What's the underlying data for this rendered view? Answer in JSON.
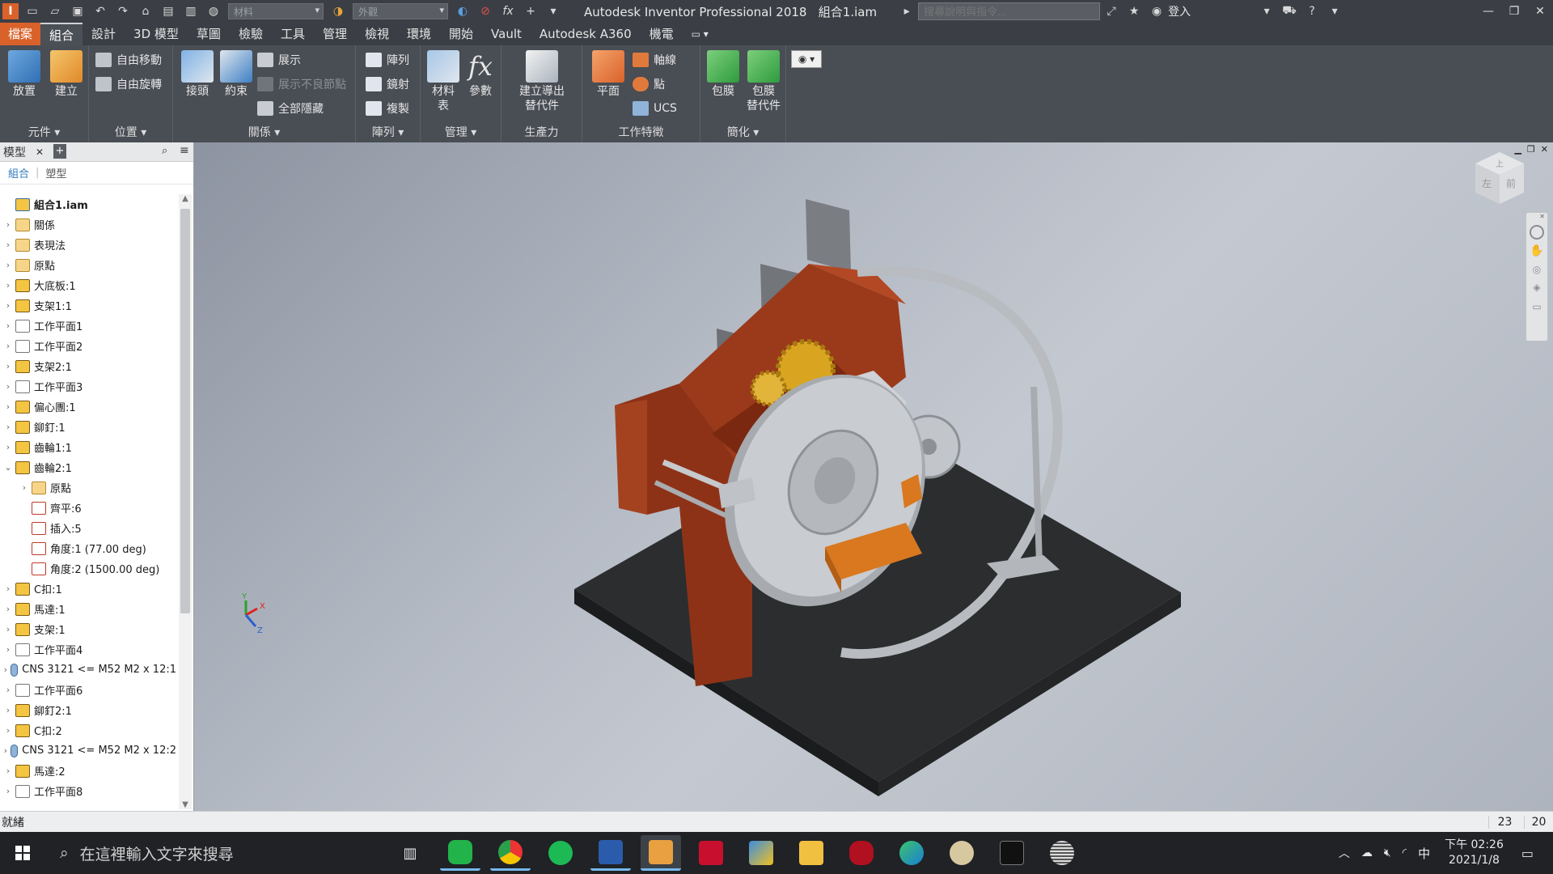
{
  "window": {
    "app_title": "Autodesk Inventor Professional 2018",
    "document": "組合1.iam",
    "search_placeholder": "搜尋說明與指令...",
    "sign_in": "登入",
    "material_placeholder": "材料",
    "appearance_placeholder": "外觀"
  },
  "menu": {
    "tabs": [
      "檔案",
      "組合",
      "設計",
      "3D 模型",
      "草圖",
      "檢驗",
      "工具",
      "管理",
      "檢視",
      "環境",
      "開始",
      "Vault",
      "Autodesk A360",
      "機電"
    ]
  },
  "ribbon": {
    "component": {
      "label": "元件",
      "place": "放置",
      "create": "建立"
    },
    "position": {
      "label": "位置",
      "free_move": "自由移動",
      "free_rotate": "自由旋轉"
    },
    "relationships": {
      "label": "關係",
      "joint": "接頭",
      "constrain": "約束",
      "show": "展示",
      "show_sick": "展示不良節點",
      "hide_all": "全部隱藏"
    },
    "pattern": {
      "label": "陣列",
      "pattern": "陣列",
      "mirror": "鏡射",
      "copy": "複製"
    },
    "manage": {
      "label": "管理",
      "bom_line1": "材料",
      "bom_line2": "表",
      "parameters": "參數"
    },
    "productivity": {
      "label": "生產力",
      "line1": "建立導出",
      "line2": "替代件"
    },
    "work_features": {
      "label": "工作特徵",
      "plane": "平面",
      "axis": "軸線",
      "point": "點",
      "ucs": "UCS"
    },
    "simplification": {
      "label": "簡化",
      "shrinkwrap": "包膜",
      "shrinkwrap_sub_line1": "包膜",
      "shrinkwrap_sub_line2": "替代件"
    }
  },
  "browser": {
    "title": "模型",
    "sub_tabs": [
      "組合",
      "塑型"
    ],
    "items": [
      {
        "label": "組合1.iam",
        "icon": "assembly",
        "indent": 0,
        "expand": "",
        "bold": true
      },
      {
        "label": "關係",
        "icon": "folder",
        "indent": 0,
        "expand": "›"
      },
      {
        "label": "表現法",
        "icon": "folder",
        "indent": 0,
        "expand": "›"
      },
      {
        "label": "原點",
        "icon": "folder",
        "indent": 0,
        "expand": "›"
      },
      {
        "label": "大底板:1",
        "icon": "part",
        "indent": 0,
        "expand": "›"
      },
      {
        "label": "支架1:1",
        "icon": "part",
        "indent": 0,
        "expand": "›"
      },
      {
        "label": "工作平面1",
        "icon": "plane",
        "indent": 0,
        "expand": "›"
      },
      {
        "label": "工作平面2",
        "icon": "plane",
        "indent": 0,
        "expand": "›"
      },
      {
        "label": "支架2:1",
        "icon": "part",
        "indent": 0,
        "expand": "›"
      },
      {
        "label": "工作平面3",
        "icon": "plane",
        "indent": 0,
        "expand": "›"
      },
      {
        "label": "偏心團:1",
        "icon": "part",
        "indent": 0,
        "expand": "›"
      },
      {
        "label": "鉚釘:1",
        "icon": "part",
        "indent": 0,
        "expand": "›"
      },
      {
        "label": "齒輪1:1",
        "icon": "part",
        "indent": 0,
        "expand": "›"
      },
      {
        "label": "齒輪2:1",
        "icon": "part",
        "indent": 0,
        "expand": "⌄"
      },
      {
        "label": "原點",
        "icon": "folder",
        "indent": 1,
        "expand": "›"
      },
      {
        "label": "齊平:6",
        "icon": "constraint",
        "indent": 1,
        "expand": ""
      },
      {
        "label": "插入:5",
        "icon": "constraint",
        "indent": 1,
        "expand": ""
      },
      {
        "label": "角度:1 (77.00 deg)",
        "icon": "constraint",
        "indent": 1,
        "expand": ""
      },
      {
        "label": "角度:2 (1500.00 deg)",
        "icon": "constraint",
        "indent": 1,
        "expand": ""
      },
      {
        "label": "C扣:1",
        "icon": "part",
        "indent": 0,
        "expand": "›"
      },
      {
        "label": "馬達:1",
        "icon": "part",
        "indent": 0,
        "expand": "›"
      },
      {
        "label": "支架:1",
        "icon": "part",
        "indent": 0,
        "expand": "›"
      },
      {
        "label": "工作平面4",
        "icon": "plane",
        "indent": 0,
        "expand": "›"
      },
      {
        "label": "CNS 3121 <= M52 M2 x 12:1",
        "icon": "fastener",
        "indent": 0,
        "expand": "›"
      },
      {
        "label": "工作平面6",
        "icon": "plane",
        "indent": 0,
        "expand": "›"
      },
      {
        "label": "鉚釘2:1",
        "icon": "part",
        "indent": 0,
        "expand": "›"
      },
      {
        "label": "C扣:2",
        "icon": "part",
        "indent": 0,
        "expand": "›"
      },
      {
        "label": "CNS 3121 <= M52 M2 x 12:2",
        "icon": "fastener",
        "indent": 0,
        "expand": "›"
      },
      {
        "label": "馬達:2",
        "icon": "part",
        "indent": 0,
        "expand": "›"
      },
      {
        "label": "工作平面8",
        "icon": "plane",
        "indent": 0,
        "expand": "›"
      }
    ]
  },
  "viewcube": {
    "top": "上",
    "front": "前",
    "left": "左"
  },
  "axes": {
    "x": "X",
    "y": "Y",
    "z": "Z"
  },
  "status": {
    "text": "就緒",
    "count1": "23",
    "count2": "20"
  },
  "taskbar": {
    "search_placeholder": "在這裡輸入文字來搜尋",
    "time": "下午 02:26",
    "date": "2021/1/8",
    "ime": "中"
  },
  "colors": {
    "accent_file_tab": "#d9622b",
    "frame_red": "#9b3a1a",
    "base_plate": "#2e2f31",
    "gear_gold": "#d9a520",
    "orange_block": "#d9781f"
  }
}
